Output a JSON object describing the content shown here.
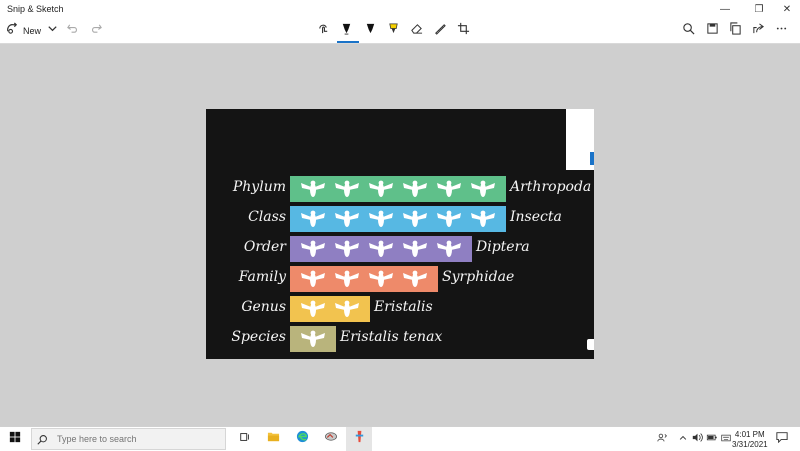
{
  "window": {
    "title": "Snip & Sketch",
    "controls": {
      "minimize": "—",
      "restore": "❐",
      "close": "✕"
    }
  },
  "toolbar": {
    "new_label": "New",
    "left_icons": [
      "new-snip-icon",
      "chevron-down-icon",
      "undo-icon",
      "redo-icon"
    ],
    "center_tools": [
      "touch-writing-icon",
      "ballpoint-pen-icon",
      "pencil-icon",
      "highlighter-icon",
      "eraser-icon",
      "ruler-icon",
      "crop-icon"
    ],
    "active_tool": "ballpoint-pen-icon",
    "right_icons": [
      "zoom-icon",
      "save-icon",
      "copy-icon",
      "share-icon",
      "more-icon"
    ]
  },
  "image": {
    "rows": [
      {
        "rank": "Phylum",
        "taxon": "Arthropoda",
        "color": "#5fc08a",
        "insects": 6
      },
      {
        "rank": "Class",
        "taxon": "Insecta",
        "color": "#57b8e3",
        "insects": 6
      },
      {
        "rank": "Order",
        "taxon": "Diptera",
        "color": "#8f7fc2",
        "insects": 5
      },
      {
        "rank": "Family",
        "taxon": "Syrphidae",
        "color": "#ee8a6a",
        "insects": 4
      },
      {
        "rank": "Genus",
        "taxon": "Eristalis",
        "color": "#f2c34f",
        "insects": 2
      },
      {
        "rank": "Species",
        "taxon": "Eristalis tenax",
        "color": "#b9b47c",
        "insects": 1
      }
    ]
  },
  "taskbar": {
    "search_placeholder": "Type here to search",
    "pinned": [
      "task-view-icon",
      "file-explorer-icon",
      "edge-icon",
      "photos-icon",
      "snip-sketch-icon"
    ],
    "tray": [
      "people-icon",
      "chevron-up-icon",
      "volume-icon",
      "battery-icon",
      "keyboard-icon"
    ],
    "time": "4:01 PM",
    "date": "3/31/2021"
  }
}
